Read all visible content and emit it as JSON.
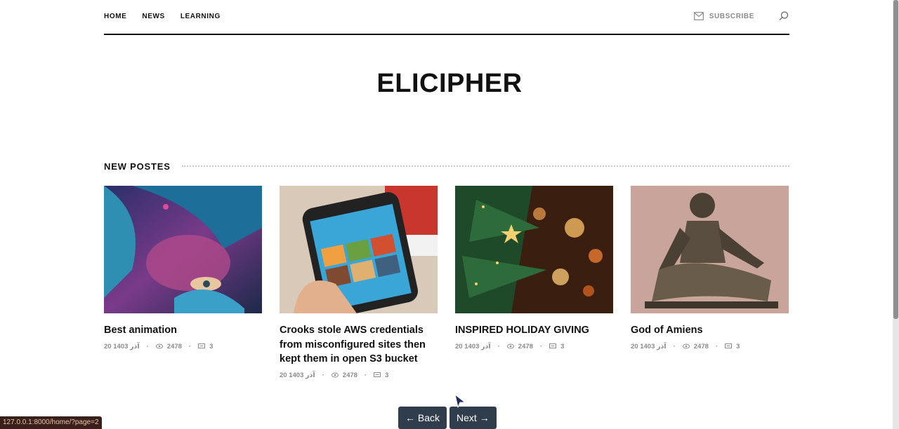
{
  "nav": {
    "links": [
      "HOME",
      "NEWS",
      "LEARNING"
    ],
    "subscribe": "SUBSCRIBE"
  },
  "site_title": "ELICIPHER",
  "section_title": "NEW POSTES",
  "posts": [
    {
      "title": "Best animation",
      "date": "20 آذر 1403",
      "views": "2478",
      "comments": "3"
    },
    {
      "title": "Crooks stole AWS credentials from misconfigured sites then kept them in open S3 bucket",
      "date": "20 آذر 1403",
      "views": "2478",
      "comments": "3"
    },
    {
      "title": "INSPIRED HOLIDAY GIVING",
      "date": "20 آذر 1403",
      "views": "2478",
      "comments": "3"
    },
    {
      "title": "God of Amiens",
      "date": "20 آذر 1403",
      "views": "2478",
      "comments": "3"
    }
  ],
  "pager": {
    "back": "← Back",
    "next": "Next →"
  },
  "status_url": "127.0.0.1:8000/home/?page=2",
  "colors": {
    "accent": "#2f3d4c",
    "text": "#111111",
    "muted": "#8a8a8a"
  }
}
